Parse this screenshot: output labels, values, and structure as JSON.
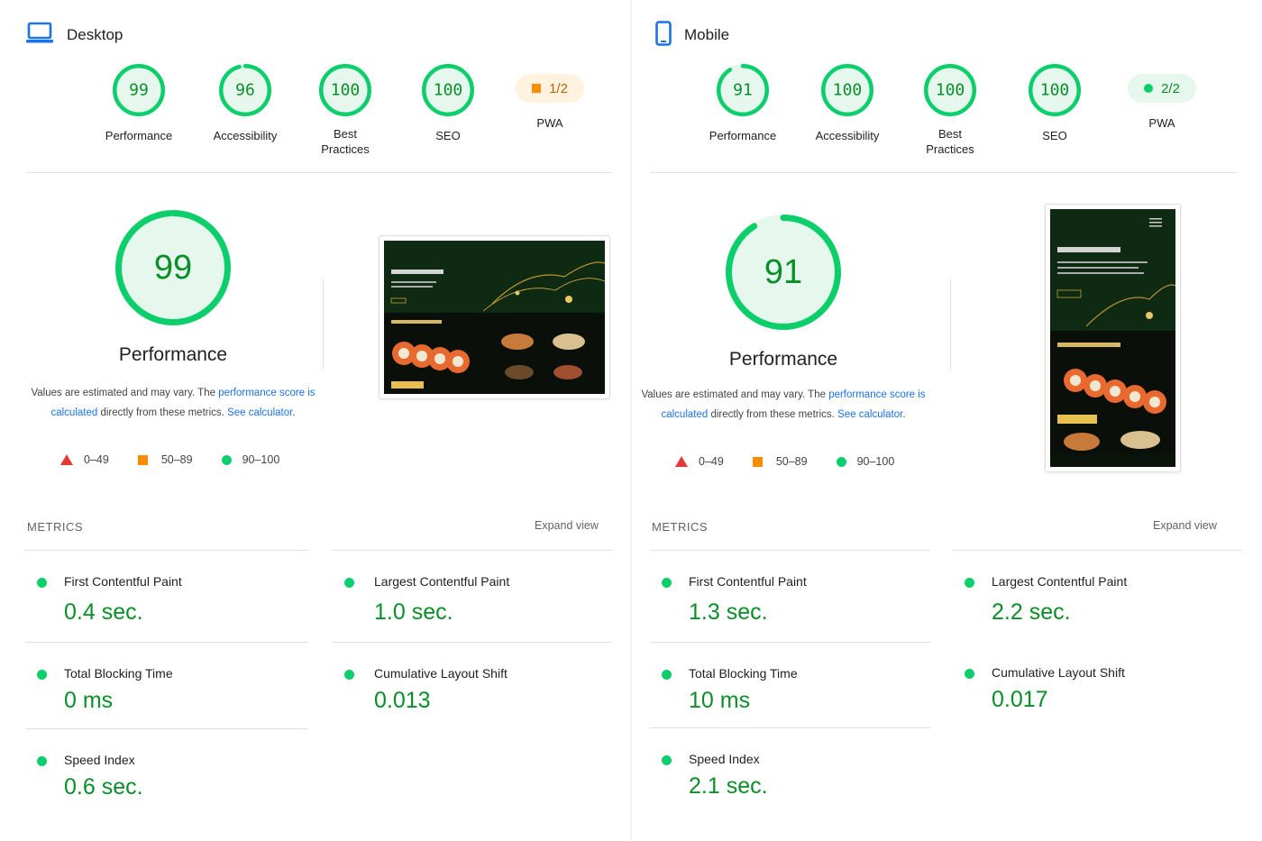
{
  "colors": {
    "pass": "#0cce6b",
    "pass_text": "#0a8f28",
    "average": "#fb8c00",
    "fail": "#e53935",
    "link": "#1a73e8"
  },
  "desktop": {
    "title": "Desktop",
    "icon": "laptop-icon",
    "gauges": [
      {
        "score": 99,
        "label": "Performance"
      },
      {
        "score": 96,
        "label": "Accessibility"
      },
      {
        "score": 100,
        "label": "Best Practices"
      },
      {
        "score": 100,
        "label": "SEO"
      }
    ],
    "pwa": {
      "value": "1/2",
      "label": "PWA",
      "status": "average"
    },
    "performance": {
      "score": 99,
      "title": "Performance"
    },
    "note": {
      "pre": "Values are estimated and may vary. The ",
      "link1": "performance score is calculated",
      "mid": " directly from these metrics. ",
      "link2": "See calculator",
      "post": "."
    },
    "legend": [
      "0–49",
      "50–89",
      "90–100"
    ],
    "metrics_heading": "METRICS",
    "expand_label": "Expand view",
    "metrics": [
      {
        "name": "First Contentful Paint",
        "value": "0.4 sec."
      },
      {
        "name": "Largest Contentful Paint",
        "value": "1.0 sec."
      },
      {
        "name": "Total Blocking Time",
        "value": "0 ms"
      },
      {
        "name": "Cumulative Layout Shift",
        "value": "0.013"
      },
      {
        "name": "Speed Index",
        "value": "0.6 sec."
      }
    ],
    "screenshot": {
      "brand": "SUSHI GOLD",
      "hero": "Доставка суши",
      "menu": "Menu Sushi Gold",
      "badge": "Роллы • Суши"
    }
  },
  "mobile": {
    "title": "Mobile",
    "icon": "phone-icon",
    "gauges": [
      {
        "score": 91,
        "label": "Performance"
      },
      {
        "score": 100,
        "label": "Accessibility"
      },
      {
        "score": 100,
        "label": "Best Practices"
      },
      {
        "score": 100,
        "label": "SEO"
      }
    ],
    "pwa": {
      "value": "2/2",
      "label": "PWA",
      "status": "pass"
    },
    "performance": {
      "score": 91,
      "title": "Performance"
    },
    "note": {
      "pre": "Values are estimated and may vary. The ",
      "link1": "performance score is calculated",
      "mid": " directly from these metrics. ",
      "link2": "See calculator",
      "post": "."
    },
    "legend": [
      "0–49",
      "50–89",
      "90–100"
    ],
    "metrics_heading": "METRICS",
    "expand_label": "Expand view",
    "metrics": [
      {
        "name": "First Contentful Paint",
        "value": "1.3 sec."
      },
      {
        "name": "Largest Contentful Paint",
        "value": "2.2 sec."
      },
      {
        "name": "Total Blocking Time",
        "value": "10 ms"
      },
      {
        "name": "Cumulative Layout Shift",
        "value": "0.017"
      },
      {
        "name": "Speed Index",
        "value": "2.1 sec."
      }
    ],
    "screenshot": {
      "brand": "SUSHI GOLD",
      "hero": "Доставка суши",
      "menu": "Menu Sushi Gold",
      "badge": "Роллы • Суши"
    }
  }
}
